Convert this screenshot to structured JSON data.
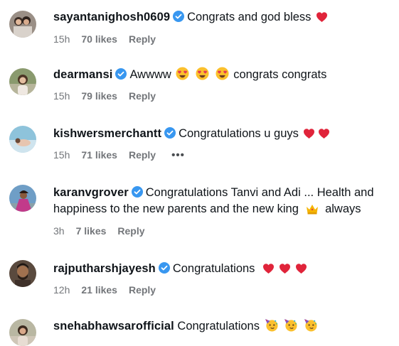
{
  "comments": [
    {
      "username": "sayantanighosh0609",
      "verified": true,
      "text": "Congrats and god bless",
      "emoji": [
        "red-heart"
      ],
      "time": "15h",
      "likes": "70 likes",
      "reply": "Reply"
    },
    {
      "username": "dearmansi",
      "verified": true,
      "text_before": "Awwww",
      "emoji": [
        "heart-eyes-face",
        "heart-eyes-face",
        "heart-eyes-face"
      ],
      "text_after": "congrats congrats",
      "time": "15h",
      "likes": "79 likes",
      "reply": "Reply"
    },
    {
      "username": "kishwersmerchantt",
      "verified": true,
      "text": "Congratulations u guys",
      "emoji": [
        "red-heart",
        "red-heart"
      ],
      "time": "15h",
      "likes": "71 likes",
      "reply": "Reply",
      "more": "•••"
    },
    {
      "username": "karanvgrover",
      "verified": true,
      "text_line1": "Congratulations Tanvi and Adi ... Health and",
      "text_line2": "happiness to the new parents and the new king",
      "emoji": [
        "crown"
      ],
      "text_after": "always",
      "time": "3h",
      "likes": "7 likes",
      "reply": "Reply"
    },
    {
      "username": "rajputharshjayesh",
      "verified": true,
      "text": "Congratulations",
      "emoji": [
        "red-heart",
        "red-heart",
        "red-heart"
      ],
      "time": "12h",
      "likes": "21 likes",
      "reply": "Reply"
    },
    {
      "username": "snehabhawsarofficial",
      "verified": false,
      "text": "Congratulations",
      "emoji": [
        "partying-face",
        "partying-face",
        "partying-face"
      ]
    }
  ],
  "colors": {
    "verified_blue": "#3897f0",
    "meta_gray": "#73767a",
    "heart_red": "#e0243a"
  }
}
